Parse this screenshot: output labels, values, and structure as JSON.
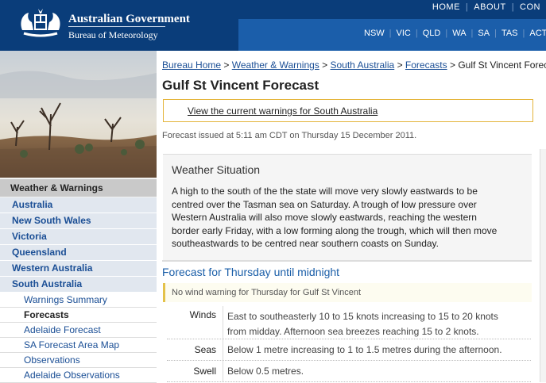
{
  "header": {
    "gov_title": "Australian Government",
    "bom_title": "Bureau of Meteorology",
    "top_links": [
      "HOME",
      "ABOUT",
      "CON"
    ],
    "states": [
      "NSW",
      "VIC",
      "QLD",
      "WA",
      "SA",
      "TAS",
      "ACT"
    ]
  },
  "sidebar": {
    "heading": "Weather & Warnings",
    "items": [
      "Australia",
      "New South Wales",
      "Victoria",
      "Queensland",
      "Western Australia",
      "South Australia"
    ],
    "sub_items": [
      "Warnings Summary",
      "Forecasts",
      "Adelaide Forecast",
      "SA Forecast Area Map",
      "Observations",
      "Adelaide Observations"
    ]
  },
  "breadcrumb": {
    "items": [
      "Bureau Home",
      "Weather & Warnings",
      "South Australia",
      "Forecasts"
    ],
    "separator": ">",
    "current": "Gulf St Vincent Forecast"
  },
  "page": {
    "title": "Gulf St Vincent Forecast",
    "warning_link": "View the current warnings for South Australia",
    "issued": "Forecast issued at 5:11 am CDT on Thursday 15 December 2011."
  },
  "situation": {
    "title": "Weather Situation",
    "lines": [
      "A high to the south of the the state will move very slowly eastwards to be",
      "centred over the Tasman sea on Saturday. A trough of low pressure over",
      "Western Australia will also move slowly eastwards, reaching the western",
      "border early Friday, with a low forming along the trough, which will then move",
      "southeastwards to be centred near southern coasts on Sunday."
    ]
  },
  "forecast": {
    "title": "Forecast for Thursday until midnight",
    "no_wind_warning": "No wind warning for Thursday for Gulf St Vincent",
    "rows": [
      {
        "label": "Winds",
        "lines": [
          "East to southeasterly 10 to 15 knots increasing to 15 to 20 knots",
          "from midday. Afternoon sea breezes reaching 15 to 2 knots."
        ]
      },
      {
        "label": "Seas",
        "lines": [
          "Below 1 metre increasing to 1 to 1.5 metres during the afternoon."
        ]
      },
      {
        "label": "Swell",
        "lines": [
          "Below 0.5 metres."
        ]
      }
    ]
  },
  "colors": {
    "header_dark": "#0a3d7a",
    "header_blue": "#1b5eaa",
    "link": "#1a4e95",
    "warning_border": "#e4b43a"
  }
}
